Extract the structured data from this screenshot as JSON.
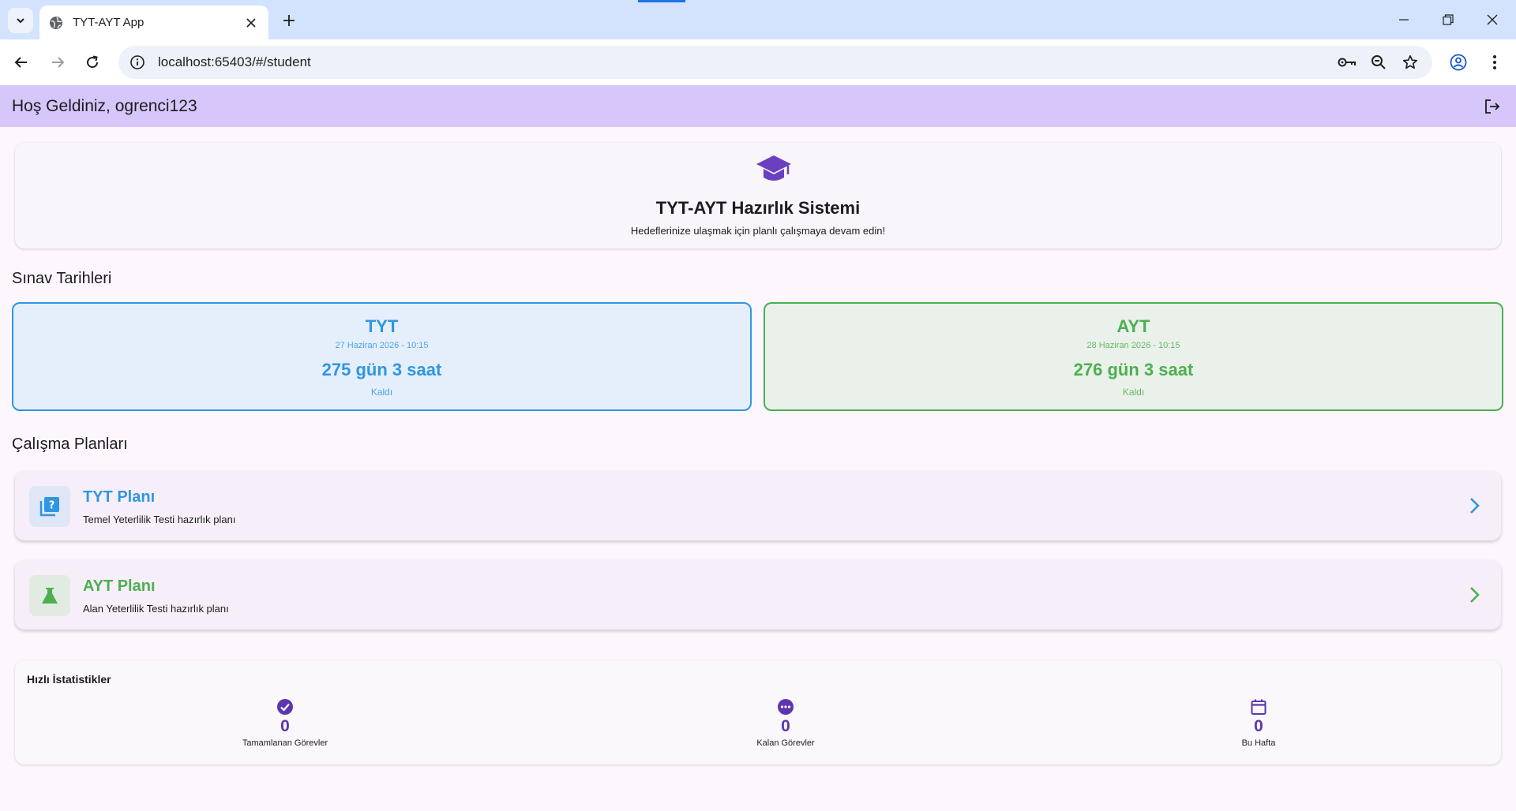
{
  "browser": {
    "tab_title": "TYT-AYT App",
    "url": "localhost:65403/#/student"
  },
  "app": {
    "greeting": "Hoş Geldiniz, ogrenci123"
  },
  "hero": {
    "title": "TYT-AYT Hazırlık Sistemi",
    "subtitle": "Hedeflerinize ulaşmak için planlı çalışmaya devam edin!",
    "icon": "graduation-cap-icon"
  },
  "exams_section": {
    "title": "Sınav Tarihleri",
    "exams": [
      {
        "name": "TYT",
        "date": "27 Haziran 2026 - 10:15",
        "remaining": "275 gün 3 saat",
        "left_label": "Kaldı",
        "color": "#2f96e2"
      },
      {
        "name": "AYT",
        "date": "28 Haziran 2026 - 10:15",
        "remaining": "276 gün 3 saat",
        "left_label": "Kaldı",
        "color": "#4caf50"
      }
    ]
  },
  "plans_section": {
    "title": "Çalışma Planları",
    "plans": [
      {
        "title": "TYT Planı",
        "subtitle": "Temel Yeterlilik Testi hazırlık planı",
        "icon": "quiz-icon",
        "color": "#2f96e2"
      },
      {
        "title": "AYT Planı",
        "subtitle": "Alan Yeterlilik Testi hazırlık planı",
        "icon": "flask-icon",
        "color": "#4caf50"
      }
    ]
  },
  "stats": {
    "title": "Hızlı İstatistikler",
    "items": [
      {
        "value": "0",
        "label": "Tamamlanan Görevler",
        "icon": "check-circle-icon"
      },
      {
        "value": "0",
        "label": "Kalan Görevler",
        "icon": "pending-icon"
      },
      {
        "value": "0",
        "label": "Bu Hafta",
        "icon": "calendar-icon"
      }
    ],
    "accent": "#5e35b1"
  }
}
